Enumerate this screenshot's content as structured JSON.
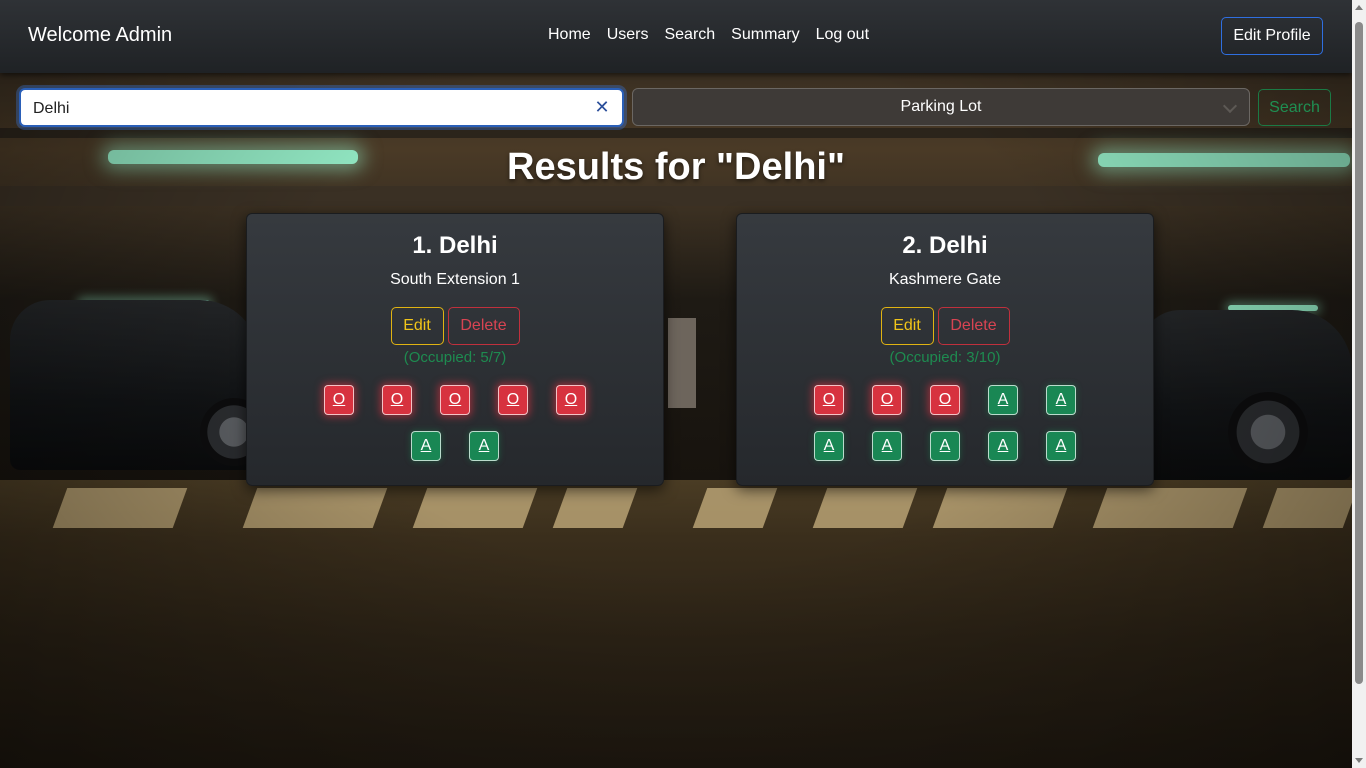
{
  "navbar": {
    "brand": "Welcome Admin",
    "links": [
      {
        "label": "Home"
      },
      {
        "label": "Users"
      },
      {
        "label": "Search"
      },
      {
        "label": "Summary"
      },
      {
        "label": "Log out"
      }
    ],
    "edit_profile_label": "Edit Profile"
  },
  "search": {
    "value": "Delhi",
    "clear_icon": "close-icon",
    "category_selected": "Parking Lot",
    "button_label": "Search"
  },
  "results": {
    "title": "Results for \"Delhi\"",
    "lots": [
      {
        "title": "1. Delhi",
        "address": "South Extension 1",
        "edit_label": "Edit",
        "delete_label": "Delete",
        "occupancy": "(Occupied: 5/7)",
        "spots": [
          "O",
          "O",
          "O",
          "O",
          "O",
          "A",
          "A"
        ]
      },
      {
        "title": "2. Delhi",
        "address": "Kashmere Gate",
        "edit_label": "Edit",
        "delete_label": "Delete",
        "occupancy": "(Occupied: 3/10)",
        "spots": [
          "O",
          "O",
          "O",
          "A",
          "A",
          "A",
          "A",
          "A",
          "A",
          "A"
        ]
      }
    ]
  },
  "colors": {
    "occupied": "#d7323f",
    "available": "#198754",
    "edit": "#f0c419",
    "delete": "#d84452",
    "profile_border": "#2f6fe0"
  }
}
